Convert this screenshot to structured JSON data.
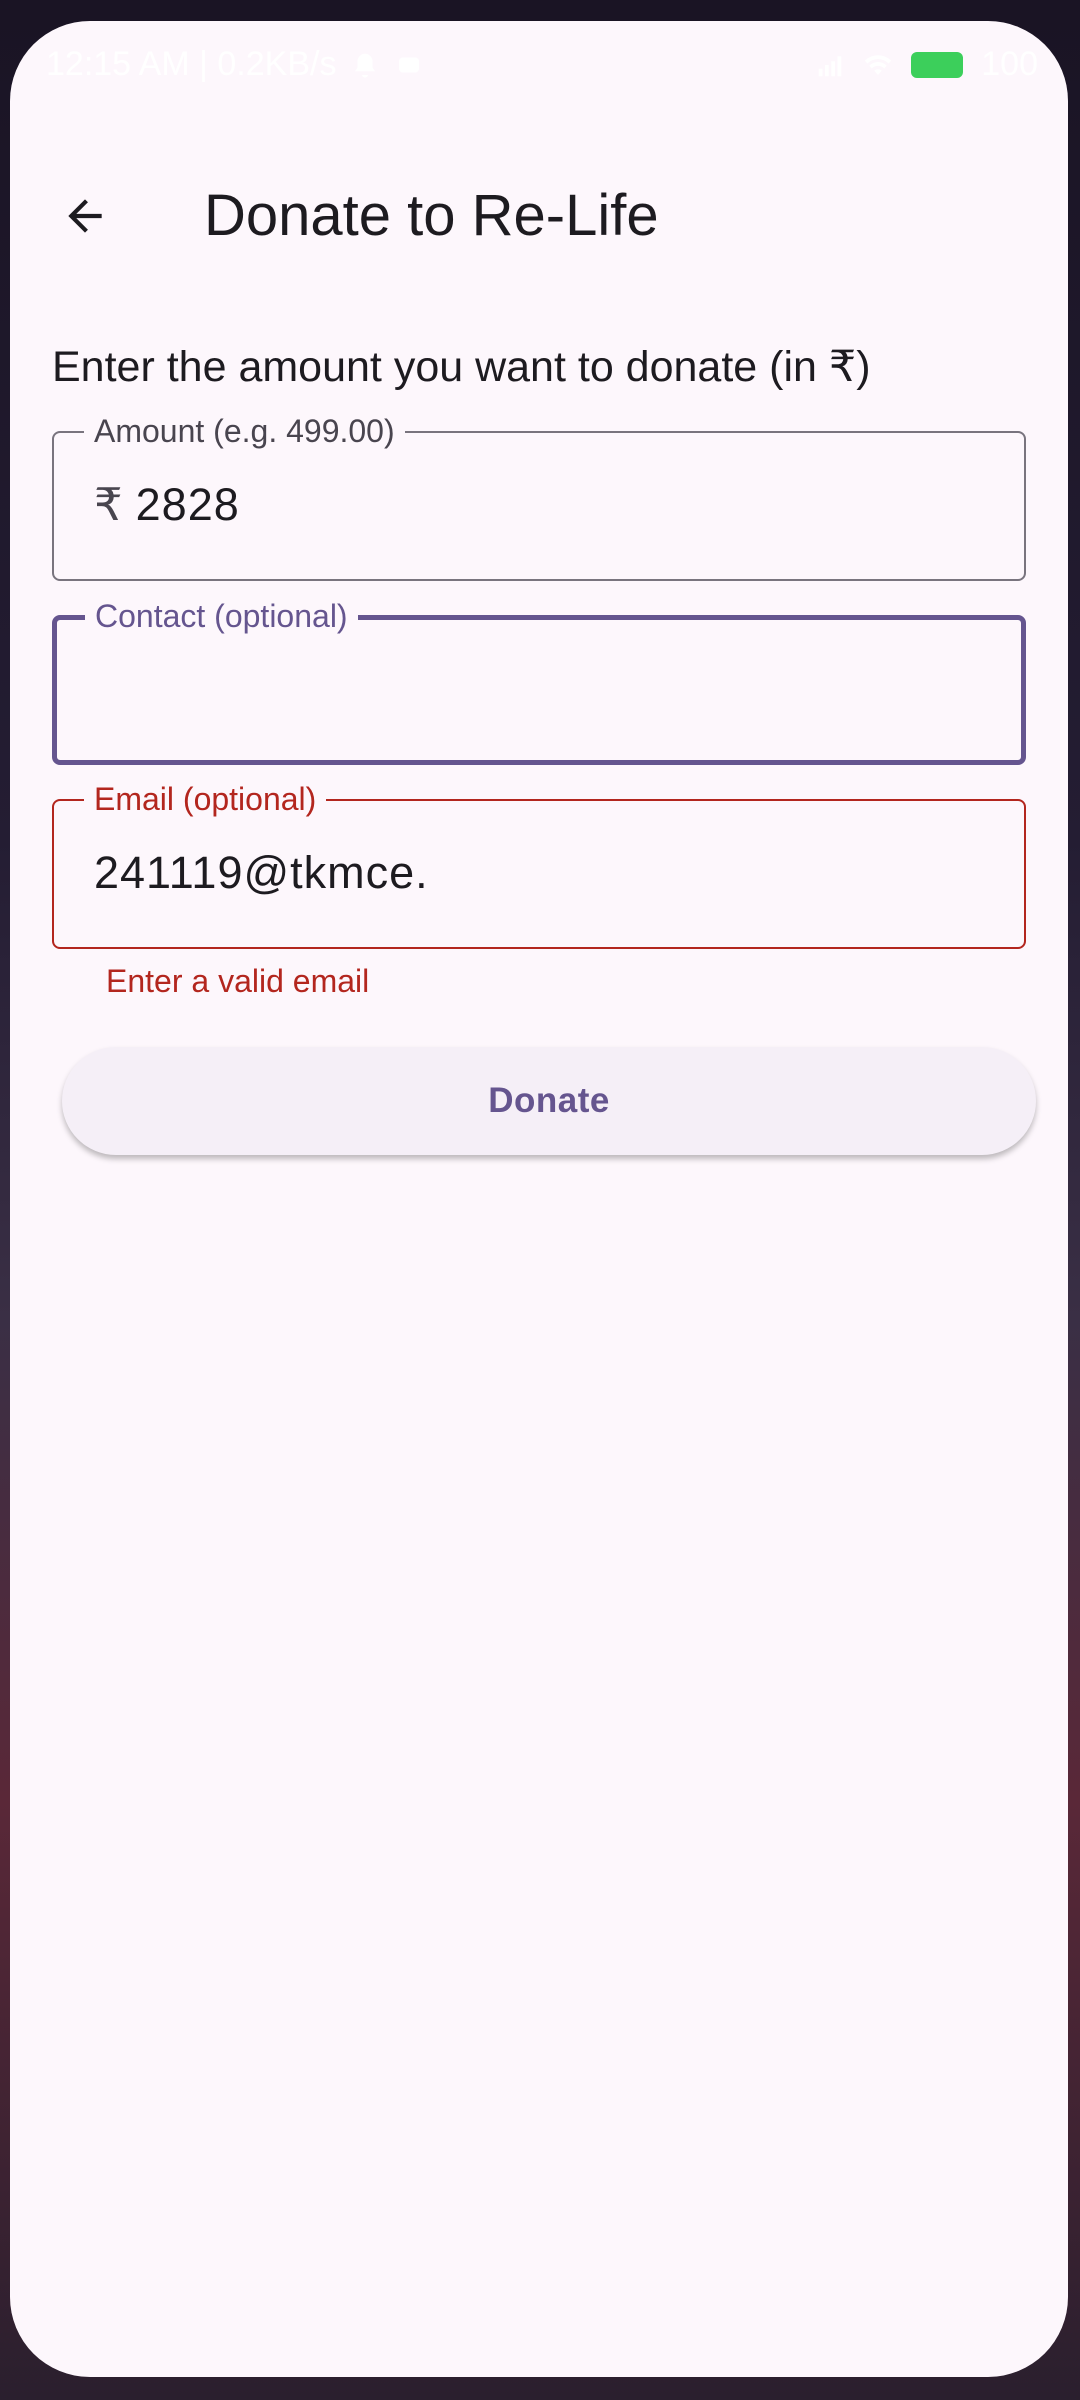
{
  "status_bar": {
    "time": "12:15 AM | 0.2KB/s",
    "battery": "100"
  },
  "app_bar": {
    "back_icon": "arrow-back-icon",
    "title": "Donate to Re-Life"
  },
  "form": {
    "prompt": "Enter the amount you want to donate (in ₹)",
    "amount": {
      "label": "Amount (e.g. 499.00)",
      "prefix": "₹",
      "value": "2828"
    },
    "contact": {
      "label": "Contact (optional)",
      "value": ""
    },
    "email": {
      "label": "Email (optional)",
      "value": "241119@tkmce.",
      "error": "Enter a valid email"
    },
    "donate_label": "Donate"
  },
  "colors": {
    "primary": "#65558f",
    "error": "#b3261e",
    "background": "#fdf7fc",
    "outline": "#79747e"
  }
}
